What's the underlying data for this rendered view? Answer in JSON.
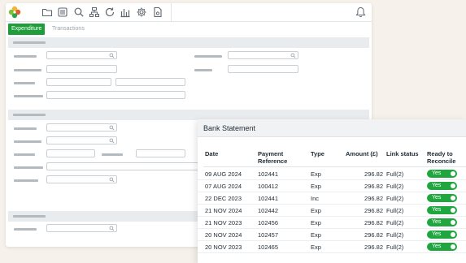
{
  "colors": {
    "accent": "#1f9d3a",
    "toggle_on": "#1fa63e",
    "background": "#f6f1ea"
  },
  "toolbar": {
    "logo": "flower-logo-icon",
    "icons": [
      "folder-icon",
      "stack-icon",
      "search-icon",
      "sitemap-icon",
      "refresh-icon",
      "bar-chart-icon",
      "gear-icon",
      "file-settings-icon"
    ],
    "right_icon": "bell-icon"
  },
  "tabs": {
    "active": "Expenditure",
    "inactive": "Transactions"
  },
  "bank_statement": {
    "title": "Bank Statement",
    "columns": {
      "date": "Date",
      "ref_line1": "Payment",
      "ref_line2": "Reference",
      "type": "Type",
      "amount": "Amount (£)",
      "link": "Link status",
      "ready_line1": "Ready to",
      "ready_line2": "Reconcile"
    },
    "rows": [
      {
        "date": "09 AUG 2024",
        "ref": "102441",
        "type": "Exp",
        "amount": "296.82",
        "link": "Full(2)",
        "ready": "Yes"
      },
      {
        "date": "07 AUG 2024",
        "ref": "100412",
        "type": "Exp",
        "amount": "296.82",
        "link": "Full(2)",
        "ready": "Yes"
      },
      {
        "date": "22 DEC 2023",
        "ref": "102441",
        "type": "Inc",
        "amount": "296.82",
        "link": "Full(2)",
        "ready": "Yes"
      },
      {
        "date": "21 NOV 2024",
        "ref": "102442",
        "type": "Exp",
        "amount": "296.82",
        "link": "Full(2)",
        "ready": "Yes"
      },
      {
        "date": "21 NOV 2023",
        "ref": "102456",
        "type": "Exp",
        "amount": "296.82",
        "link": "Full(2)",
        "ready": "Yes"
      },
      {
        "date": "20 NOV 2024",
        "ref": "102457",
        "type": "Exp",
        "amount": "296.82",
        "link": "Full(2)",
        "ready": "Yes"
      },
      {
        "date": "20 NOV 2023",
        "ref": "102465",
        "type": "Exp",
        "amount": "296.82",
        "link": "Full(2)",
        "ready": "Yes"
      }
    ]
  }
}
